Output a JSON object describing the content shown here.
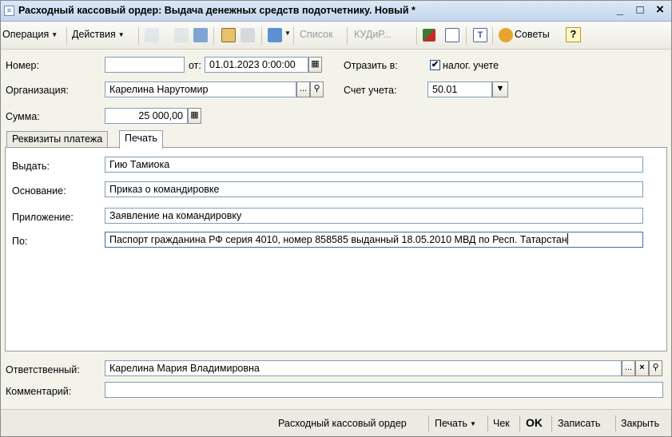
{
  "window": {
    "title": "Расходный кассовый ордер: Выдача денежных средств подотчетнику. Новый *",
    "minimize": "_",
    "maximize": "□",
    "close": "×"
  },
  "toolbar": {
    "operation": "Операция",
    "actions": "Действия",
    "list": "Список",
    "kud": "КУДиР...",
    "tips": "Советы",
    "help": "?"
  },
  "form": {
    "number_label": "Номер:",
    "number_value": "",
    "date_prefix": "от:",
    "date_value": "01.01.2023  0:00:00",
    "reflect_label": "Отразить в:",
    "reflect_option": "налог. учете",
    "reflect_checked": "✔",
    "org_label": "Организация:",
    "org_value": "Карелина Нарутомир",
    "account_label": "Счет учета:",
    "account_value": "50.01",
    "sum_label": "Сумма:",
    "sum_value": "25 000,00"
  },
  "tabs": [
    {
      "label": "Реквизиты платежа"
    },
    {
      "label": "Печать"
    }
  ],
  "print_tab": {
    "issue_label": "Выдать:",
    "issue_value": "Гию Тамиока",
    "basis_label": "Основание:",
    "basis_value": "Приказ о командировке",
    "attachment_label": "Приложение:",
    "attachment_value": "Заявление на командировку",
    "by_label": "По:",
    "by_value": "Паспорт гражданина РФ серия 4010, номер 858585 выданный 18.05.2010 МВД по Респ. Татарстан"
  },
  "footer_fields": {
    "responsible_label": "Ответственный:",
    "responsible_value": "Карелина Мария Владимировна",
    "comment_label": "Комментарий:",
    "comment_value": ""
  },
  "statusbar": {
    "order": "Расходный кассовый ордер",
    "print": "Печать",
    "check": "Чек",
    "ok": "OK",
    "save": "Записать",
    "close": "Закрыть"
  }
}
